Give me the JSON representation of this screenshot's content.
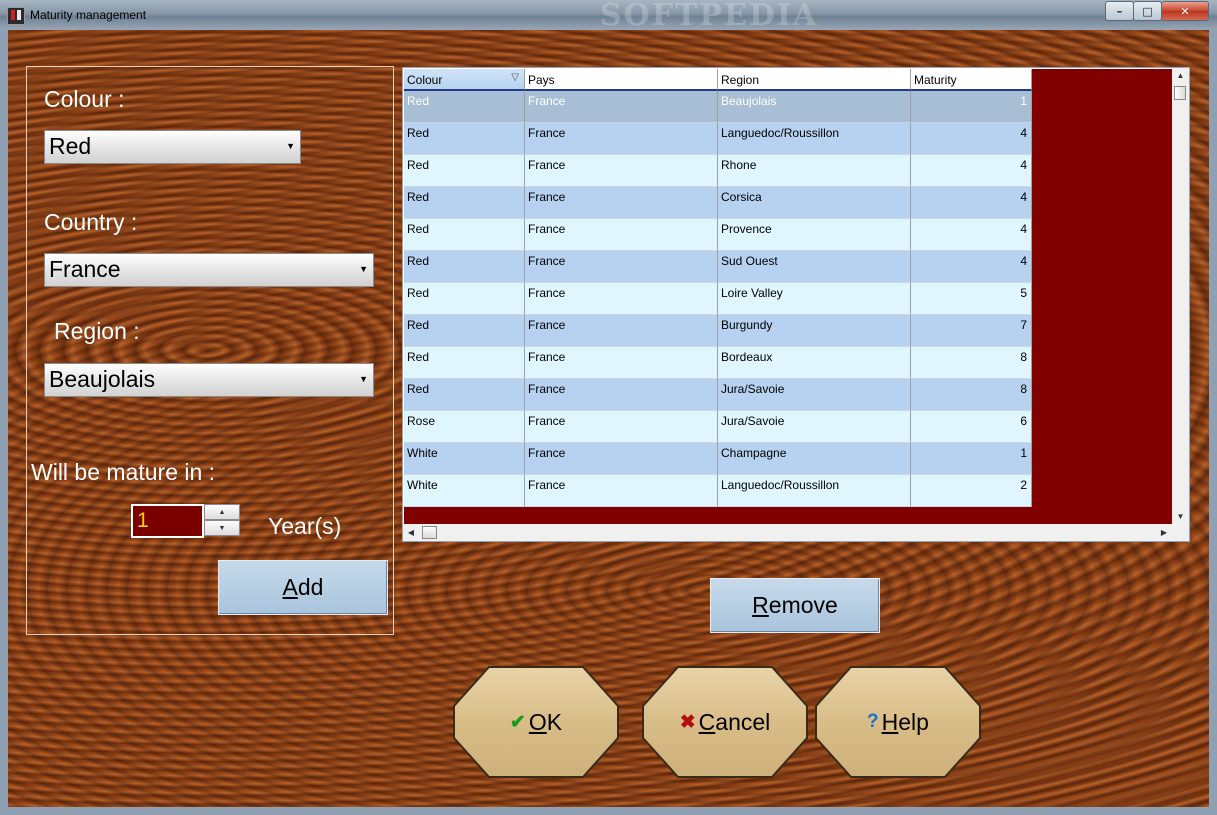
{
  "window": {
    "title": "Maturity management",
    "watermark": "SOFTPEDIA"
  },
  "colors": {
    "wood_dark": "#7a3d14",
    "grid_background": "#800000",
    "row_alt": "#b6d2f0",
    "row_normal": "#dff6ff",
    "spin_bg": "#7a0000",
    "spin_text": "#ffd400"
  },
  "form": {
    "colour_label": "Colour :",
    "colour_value": "Red",
    "country_label": "Country :",
    "country_value": "France",
    "region_label": "Region :",
    "region_value": "Beaujolais",
    "mature_label": "Will be mature in :",
    "years_value": "1",
    "years_label": "Year(s)",
    "add_button": {
      "prefix": "A",
      "rest": "dd"
    }
  },
  "grid": {
    "columns": [
      "Colour",
      "Pays",
      "Region",
      "Maturity"
    ],
    "rows": [
      [
        "Red",
        "France",
        "Beaujolais",
        "1"
      ],
      [
        "Red",
        "France",
        "Languedoc/Roussillon",
        "4"
      ],
      [
        "Red",
        "France",
        "Rhone",
        "4"
      ],
      [
        "Red",
        "France",
        "Corsica",
        "4"
      ],
      [
        "Red",
        "France",
        "Provence",
        "4"
      ],
      [
        "Red",
        "France",
        "Sud Ouest",
        "4"
      ],
      [
        "Red",
        "France",
        "Loire Valley",
        "5"
      ],
      [
        "Red",
        "France",
        "Burgundy",
        "7"
      ],
      [
        "Red",
        "France",
        "Bordeaux",
        "8"
      ],
      [
        "Red",
        "France",
        "Jura/Savoie",
        "8"
      ],
      [
        "Rose",
        "France",
        "Jura/Savoie",
        "6"
      ],
      [
        "White",
        "France",
        "Champagne",
        "1"
      ],
      [
        "White",
        "France",
        "Languedoc/Roussillon",
        "2"
      ]
    ]
  },
  "remove_button": {
    "prefix": "R",
    "rest": "emove"
  },
  "dialog_buttons": {
    "ok": {
      "icon": "✔",
      "prefix": "O",
      "rest": "K"
    },
    "cancel": {
      "icon": "✖",
      "prefix": "C",
      "rest": "ancel"
    },
    "help": {
      "icon": "?",
      "prefix": "H",
      "rest": "elp"
    }
  }
}
